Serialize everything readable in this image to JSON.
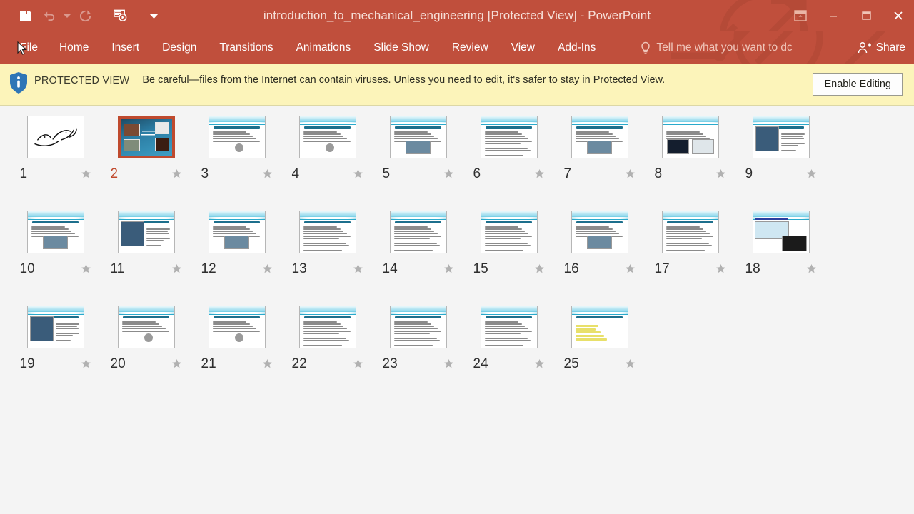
{
  "window": {
    "title": "introduction_to_mechanical_engineering [Protected View] - PowerPoint",
    "quick_access": [
      {
        "name": "save",
        "label": "Save",
        "icon": "save-icon",
        "enabled": true
      },
      {
        "name": "undo",
        "label": "Undo",
        "icon": "undo-icon",
        "enabled": false
      },
      {
        "name": "redo",
        "label": "Redo",
        "icon": "redo-icon",
        "enabled": false
      },
      {
        "name": "start-slideshow",
        "label": "Start From Beginning",
        "icon": "slideshow-icon",
        "enabled": true
      },
      {
        "name": "customize-qat",
        "label": "Customize Quick Access Toolbar",
        "icon": "chevron-down-icon",
        "enabled": true
      }
    ],
    "controls": [
      {
        "name": "ribbon-display-options",
        "label": "Ribbon Display Options",
        "icon": "ribbon-options-icon"
      },
      {
        "name": "minimize",
        "label": "Minimize",
        "icon": "minimize-icon"
      },
      {
        "name": "maximize",
        "label": "Restore Down",
        "icon": "maximize-icon"
      },
      {
        "name": "close",
        "label": "Close",
        "icon": "close-icon"
      }
    ]
  },
  "ribbon": {
    "tabs": [
      {
        "id": "file",
        "label": "File"
      },
      {
        "id": "home",
        "label": "Home"
      },
      {
        "id": "insert",
        "label": "Insert"
      },
      {
        "id": "design",
        "label": "Design"
      },
      {
        "id": "transitions",
        "label": "Transitions"
      },
      {
        "id": "animations",
        "label": "Animations"
      },
      {
        "id": "slideshow",
        "label": "Slide Show"
      },
      {
        "id": "review",
        "label": "Review"
      },
      {
        "id": "view",
        "label": "View"
      },
      {
        "id": "addins",
        "label": "Add-Ins"
      }
    ],
    "tell_me": "Tell me what you want to dc",
    "share": "Share",
    "accent_color": "#c04f3c"
  },
  "protected_view": {
    "badge": "PROTECTED VIEW",
    "message": "Be careful—files from the Internet can contain viruses. Unless you need to edit, it's safer to stay in Protected View.",
    "button": "Enable Editing",
    "background_color": "#fcf4ba",
    "shield_color": "#2e75b6"
  },
  "slides": {
    "selected": 2,
    "selection_color": "#bf4a2e",
    "items": [
      {
        "n": "1",
        "kind": "calligraphy"
      },
      {
        "n": "2",
        "kind": "title-photos"
      },
      {
        "n": "3",
        "kind": "text-figure"
      },
      {
        "n": "4",
        "kind": "text-figure"
      },
      {
        "n": "5",
        "kind": "text-photo"
      },
      {
        "n": "6",
        "kind": "text"
      },
      {
        "n": "7",
        "kind": "text-photo"
      },
      {
        "n": "8",
        "kind": "text-two-photos"
      },
      {
        "n": "9",
        "kind": "photo-text"
      },
      {
        "n": "10",
        "kind": "text-photo"
      },
      {
        "n": "11",
        "kind": "photo-text"
      },
      {
        "n": "12",
        "kind": "text-photo"
      },
      {
        "n": "13",
        "kind": "text"
      },
      {
        "n": "14",
        "kind": "text"
      },
      {
        "n": "15",
        "kind": "text"
      },
      {
        "n": "16",
        "kind": "text-photo"
      },
      {
        "n": "17",
        "kind": "text"
      },
      {
        "n": "18",
        "kind": "diagram-photo"
      },
      {
        "n": "19",
        "kind": "photo-text"
      },
      {
        "n": "20",
        "kind": "text-figure"
      },
      {
        "n": "21",
        "kind": "text-figure"
      },
      {
        "n": "22",
        "kind": "text"
      },
      {
        "n": "23",
        "kind": "text"
      },
      {
        "n": "24",
        "kind": "text"
      },
      {
        "n": "25",
        "kind": "list-highlight"
      }
    ],
    "star_icon": "star-icon"
  }
}
